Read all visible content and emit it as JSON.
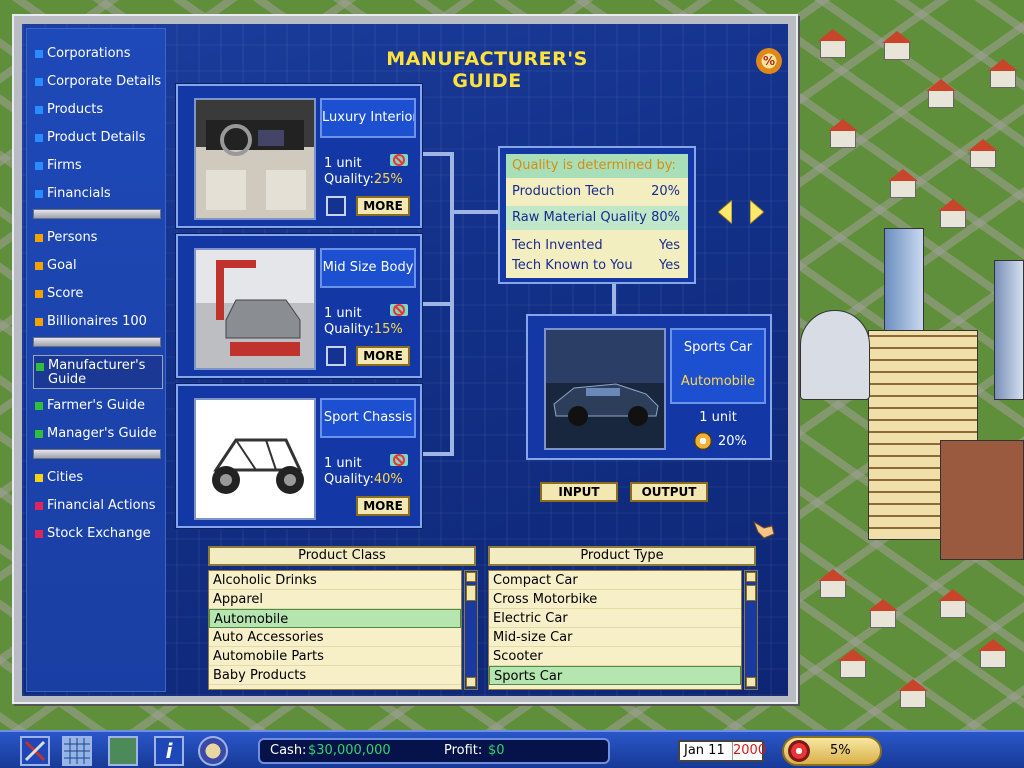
{
  "sidebar": {
    "items": [
      {
        "label": "Corporations",
        "color": "#2a8cff"
      },
      {
        "label": "Corporate Details",
        "color": "#2a8cff"
      },
      {
        "label": "Products",
        "color": "#2a8cff"
      },
      {
        "label": "Product Details",
        "color": "#2a8cff"
      },
      {
        "label": "Firms",
        "color": "#2a8cff"
      },
      {
        "label": "Financials",
        "color": "#2a8cff"
      },
      {
        "label": "Persons",
        "color": "#f2a300"
      },
      {
        "label": "Goal",
        "color": "#f2a300"
      },
      {
        "label": "Score",
        "color": "#f2a300"
      },
      {
        "label": "Billionaires 100",
        "color": "#f2a300"
      },
      {
        "label": "Manufacturer's Guide",
        "color": "#2fbf3a"
      },
      {
        "label": "Farmer's Guide",
        "color": "#2fbf3a"
      },
      {
        "label": "Manager's Guide",
        "color": "#2fbf3a"
      },
      {
        "label": "Cities",
        "color": "#f2d21a"
      },
      {
        "label": "Financial Actions",
        "color": "#e0245e"
      },
      {
        "label": "Stock Exchange",
        "color": "#e0245e"
      }
    ]
  },
  "title": "MANUFACTURER'S GUIDE",
  "help_icon": "percent-help-icon",
  "inputs": [
    {
      "name": "Luxury Interior",
      "qty": "1 unit",
      "quality_label": "Quality:",
      "quality": "25%",
      "more": "MORE"
    },
    {
      "name": "Mid Size Body",
      "qty": "1 unit",
      "quality_label": "Quality:",
      "quality": "15%",
      "more": "MORE"
    },
    {
      "name": "Sport Chassis",
      "qty": "1 unit",
      "quality_label": "Quality:",
      "quality": "40%",
      "more": "MORE"
    }
  ],
  "quality_box": {
    "heading": "Quality is determined by:",
    "rows": [
      {
        "label": "Production Tech",
        "value": "20%"
      },
      {
        "label": "Raw Material Quality",
        "value": "80%"
      },
      {
        "label": "Tech Invented",
        "value": "Yes"
      },
      {
        "label": "Tech Known to You",
        "value": "Yes"
      }
    ]
  },
  "output": {
    "name": "Sports Car",
    "category": "Automobile",
    "qty": "1 unit",
    "pct": "20%"
  },
  "buttons": {
    "input": "INPUT",
    "output": "OUTPUT"
  },
  "product_class": {
    "header": "Product Class",
    "items": [
      "Alcoholic Drinks",
      "Apparel",
      "Automobile",
      "Auto Accessories",
      "Automobile Parts",
      "Baby Products"
    ],
    "selected": "Automobile"
  },
  "product_type": {
    "header": "Product Type",
    "items": [
      "Compact Car",
      "Cross Motorbike",
      "Electric Car",
      "Mid-size Car",
      "Scooter",
      "Sports Car"
    ],
    "selected": "Sports Car"
  },
  "status": {
    "cash_label": "Cash:",
    "cash": "$30,000,000",
    "profit_label": "Profit:",
    "profit": "$0",
    "date": "Jan 11",
    "year": "2000",
    "rate": "5%"
  }
}
